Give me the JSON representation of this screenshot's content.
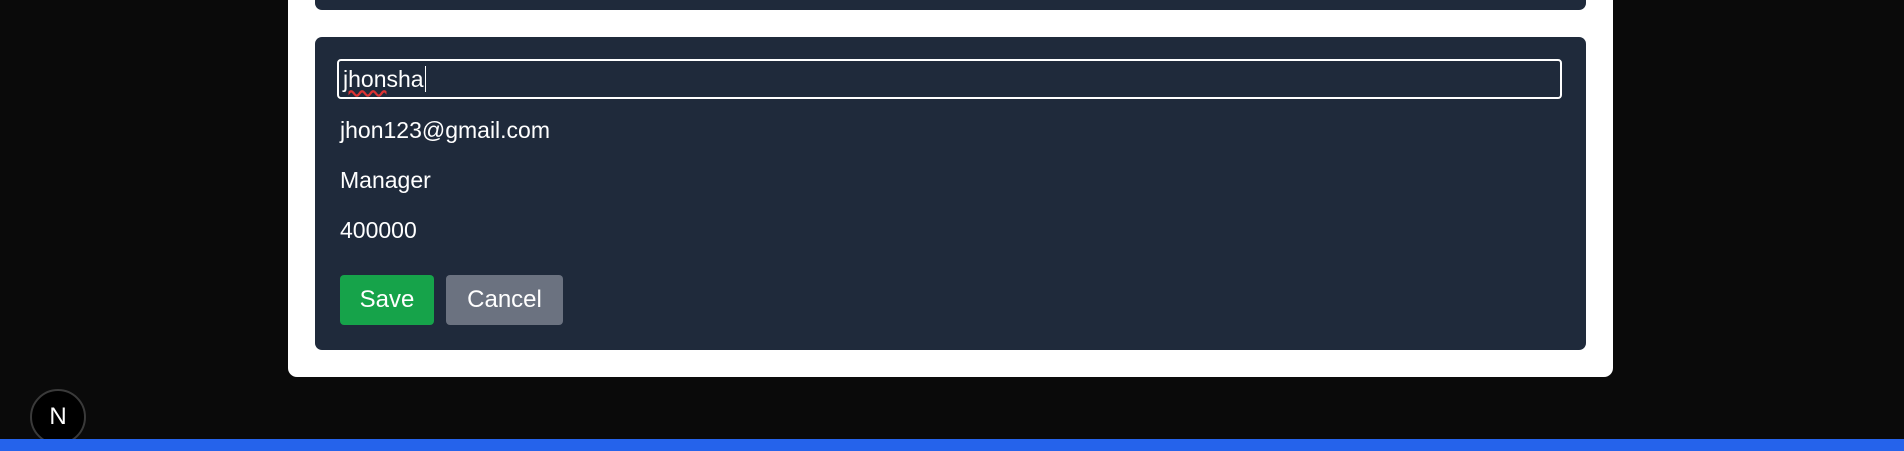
{
  "form": {
    "name_value_prefix": "jhon",
    "name_value_suffix": " sha",
    "email": "jhon123@gmail.com",
    "role": "Manager",
    "salary": "400000",
    "save_label": "Save",
    "cancel_label": "Cancel"
  },
  "badge": {
    "letter": "N"
  },
  "colors": {
    "panel": "#1f2a3b",
    "save": "#16a34a",
    "cancel": "#6b7280",
    "accent_bar": "#2563eb"
  }
}
